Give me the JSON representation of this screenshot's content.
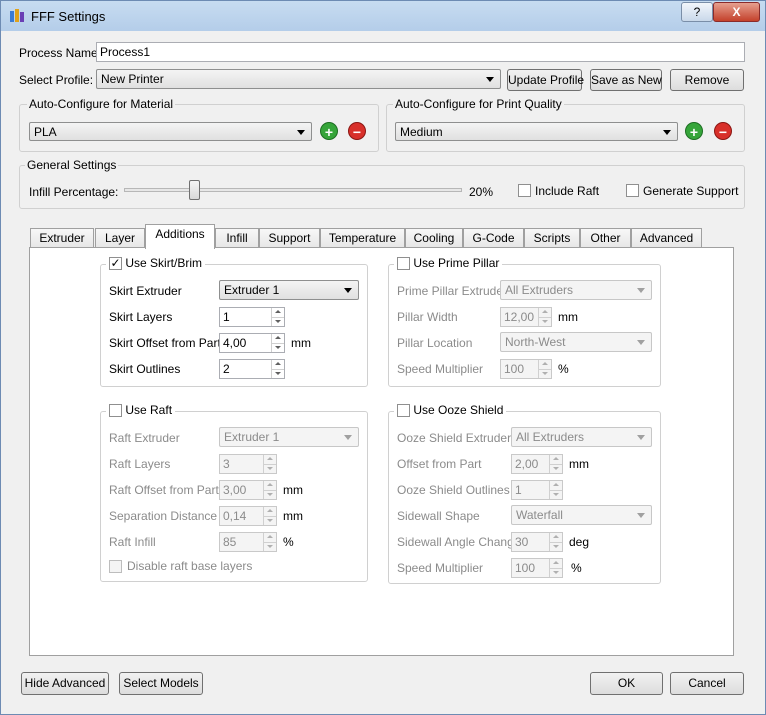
{
  "window": {
    "title": "FFF Settings",
    "help_label": "?",
    "close_label": "X"
  },
  "process": {
    "name_label": "Process Name:",
    "name_value": "Process1"
  },
  "profile": {
    "label": "Select Profile:",
    "value": "New Printer",
    "update_label": "Update Profile",
    "saveas_label": "Save as New",
    "remove_label": "Remove"
  },
  "material": {
    "title": "Auto-Configure for Material",
    "value": "PLA"
  },
  "quality": {
    "title": "Auto-Configure for Print Quality",
    "value": "Medium"
  },
  "general": {
    "title": "General Settings",
    "infill_label": "Infill Percentage:",
    "infill_value": "20%",
    "infill_fraction": 0.2,
    "raft_label": "Include Raft",
    "raft_checked": false,
    "support_label": "Generate Support",
    "support_checked": false
  },
  "tabs": [
    "Extruder",
    "Layer",
    "Additions",
    "Infill",
    "Support",
    "Temperature",
    "Cooling",
    "G-Code",
    "Scripts",
    "Other",
    "Advanced"
  ],
  "active_tab": "Additions",
  "skirt": {
    "title": "Use Skirt/Brim",
    "checked": true,
    "extruder_label": "Skirt Extruder",
    "extruder_value": "Extruder 1",
    "layers_label": "Skirt Layers",
    "layers_value": "1",
    "offset_label": "Skirt Offset from Part",
    "offset_value": "4,00",
    "offset_unit": "mm",
    "outlines_label": "Skirt Outlines",
    "outlines_value": "2"
  },
  "prime": {
    "title": "Use Prime Pillar",
    "checked": false,
    "extruder_label": "Prime Pillar Extruder",
    "extruder_value": "All Extruders",
    "width_label": "Pillar Width",
    "width_value": "12,00",
    "width_unit": "mm",
    "location_label": "Pillar Location",
    "location_value": "North-West",
    "speed_label": "Speed Multiplier",
    "speed_value": "100",
    "speed_unit": "%"
  },
  "raft": {
    "title": "Use Raft",
    "checked": false,
    "extruder_label": "Raft Extruder",
    "extruder_value": "Extruder 1",
    "layers_label": "Raft Layers",
    "layers_value": "3",
    "offset_label": "Raft Offset from Part",
    "offset_value": "3,00",
    "offset_unit": "mm",
    "separation_label": "Separation Distance",
    "separation_value": "0,14",
    "separation_unit": "mm",
    "infill_label": "Raft Infill",
    "infill_value": "85",
    "infill_unit": "%",
    "disable_label": "Disable raft base layers",
    "disable_checked": false
  },
  "ooze": {
    "title": "Use Ooze Shield",
    "checked": false,
    "extruder_label": "Ooze Shield Extruder",
    "extruder_value": "All Extruders",
    "offset_label": "Offset from Part",
    "offset_value": "2,00",
    "offset_unit": "mm",
    "outlines_label": "Ooze Shield Outlines",
    "outlines_value": "1",
    "shape_label": "Sidewall Shape",
    "shape_value": "Waterfall",
    "angle_label": "Sidewall Angle Change",
    "angle_value": "30",
    "angle_unit": "deg",
    "speed_label": "Speed Multiplier",
    "speed_value": "100",
    "speed_unit": "%"
  },
  "footer": {
    "hide_label": "Hide Advanced",
    "select_label": "Select Models",
    "ok_label": "OK",
    "cancel_label": "Cancel"
  }
}
